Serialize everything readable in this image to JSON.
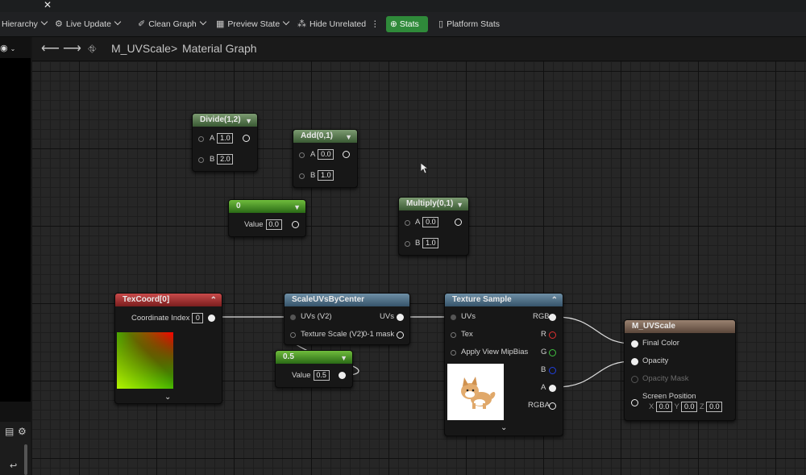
{
  "toolbar": {
    "hierarchy": "Hierarchy",
    "live_update": "Live Update",
    "clean_graph": "Clean Graph",
    "preview_state": "Preview State",
    "hide_unrelated": "Hide Unrelated",
    "stats": "Stats",
    "platform_stats": "Platform Stats"
  },
  "breadcrumb": {
    "asset": "M_UVScale",
    "separator": ">",
    "graph": "Material Graph"
  },
  "nodes": {
    "divide": {
      "title": "Divide(1,2)",
      "a_label": "A",
      "a_value": "1.0",
      "b_label": "B",
      "b_value": "2.0"
    },
    "add": {
      "title": "Add(0,1)",
      "a_label": "A",
      "a_value": "0.0",
      "b_label": "B",
      "b_value": "1.0"
    },
    "zero": {
      "title": "0",
      "value_label": "Value",
      "value": "0.0"
    },
    "multiply": {
      "title": "Multiply(0,1)",
      "a_label": "A",
      "a_value": "0.0",
      "b_label": "B",
      "b_value": "1.0"
    },
    "texcoord": {
      "title": "TexCoord[0]",
      "index_label": "Coordinate Index",
      "index_value": "0"
    },
    "scale": {
      "title": "ScaleUVsByCenter",
      "uvs_in": "UVs (V2)",
      "uvs_out": "UVs",
      "tex_scale": "Texture Scale (V2)",
      "mask_out": "0-1 mask"
    },
    "half": {
      "title": "0.5",
      "value_label": "Value",
      "value": "0.5"
    },
    "texture": {
      "title": "Texture Sample",
      "uvs": "UVs",
      "tex": "Tex",
      "mipbias": "Apply View MipBias",
      "rgb": "RGB",
      "r": "R",
      "g": "G",
      "b": "B",
      "a": "A",
      "rgba": "RGBA"
    },
    "material": {
      "title": "M_UVScale",
      "final_color": "Final Color",
      "opacity": "Opacity",
      "opacity_mask": "Opacity Mask",
      "screen_position": "Screen Position",
      "x_label": "X",
      "x_value": "0.0",
      "y_label": "Y",
      "y_value": "0.0",
      "z_label": "Z",
      "z_value": "0.0"
    }
  },
  "colors": {
    "stats_button": "#2f8a3a",
    "pin_r": "#e03030",
    "pin_g": "#40c040",
    "pin_b": "#2040e0"
  }
}
